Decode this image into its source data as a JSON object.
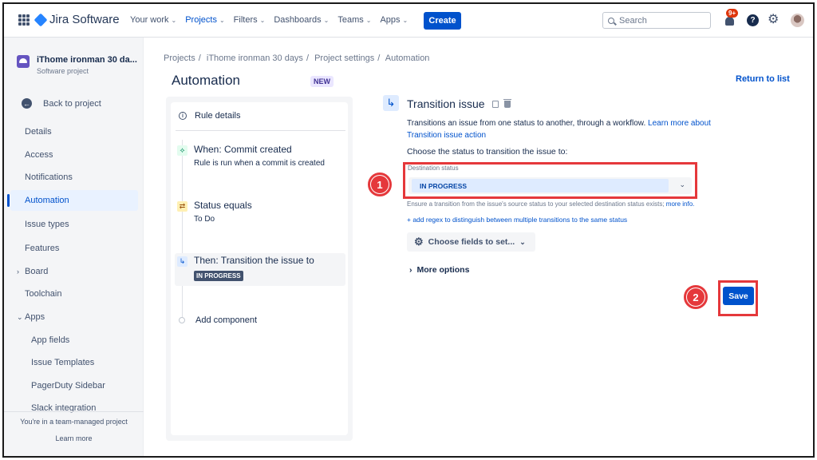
{
  "topnav": {
    "app_name": "Jira Software",
    "items": [
      {
        "label": "Your work",
        "active": false
      },
      {
        "label": "Projects",
        "active": true
      },
      {
        "label": "Filters",
        "active": false
      },
      {
        "label": "Dashboards",
        "active": false
      },
      {
        "label": "Teams",
        "active": false
      },
      {
        "label": "Apps",
        "active": false
      }
    ],
    "create_label": "Create",
    "search_placeholder": "Search",
    "notification_badge": "9+",
    "help_label": "?"
  },
  "sidebar": {
    "project_name": "iThome ironman 30 da...",
    "project_type": "Software project",
    "back_label": "Back to project",
    "items": [
      {
        "label": "Details"
      },
      {
        "label": "Access"
      },
      {
        "label": "Notifications"
      },
      {
        "label": "Automation",
        "active": true
      },
      {
        "label": "Issue types"
      },
      {
        "label": "Features"
      },
      {
        "label": "Board",
        "expandable": true
      },
      {
        "label": "Toolchain"
      },
      {
        "label": "Apps",
        "expanded": true
      },
      {
        "label": "App fields"
      },
      {
        "label": "Issue Templates"
      },
      {
        "label": "PagerDuty Sidebar"
      },
      {
        "label": "Slack integration"
      }
    ],
    "footer_text": "You're in a team-managed project",
    "footer_link": "Learn more"
  },
  "header": {
    "breadcrumbs": [
      "Projects",
      "iThome ironman 30 days",
      "Project settings",
      "Automation"
    ],
    "separator": "/",
    "title": "Automation",
    "title_badge": "NEW",
    "return_link": "Return to list"
  },
  "rule": {
    "details_label": "Rule details",
    "trigger_title": "When: Commit created",
    "trigger_sub": "Rule is run when a commit is created",
    "condition_title": "Status equals",
    "condition_sub": "To Do",
    "action_title": "Then: Transition the issue to",
    "action_status": "IN PROGRESS",
    "add_component": "Add component"
  },
  "config": {
    "title": "Transition issue",
    "desc_prefix": "Transitions an issue from one status to another, through a workflow. ",
    "desc_link": "Learn more about Transition issue action",
    "choose_label": "Choose the status to transition the issue to:",
    "dest_label": "Destination status",
    "dest_value": "IN PROGRESS",
    "ensure_text": "Ensure a transition from the issue's source status to your selected destination status exists; ",
    "ensure_link": "more info.",
    "regex_link": "+ add regex to distinguish between multiple transitions to the same status",
    "fields_button": "Choose fields to set...",
    "more_options": "More options",
    "save_label": "Save"
  },
  "annotations": {
    "marker_1": "1",
    "marker_2": "2",
    "color": "#e5383b"
  }
}
